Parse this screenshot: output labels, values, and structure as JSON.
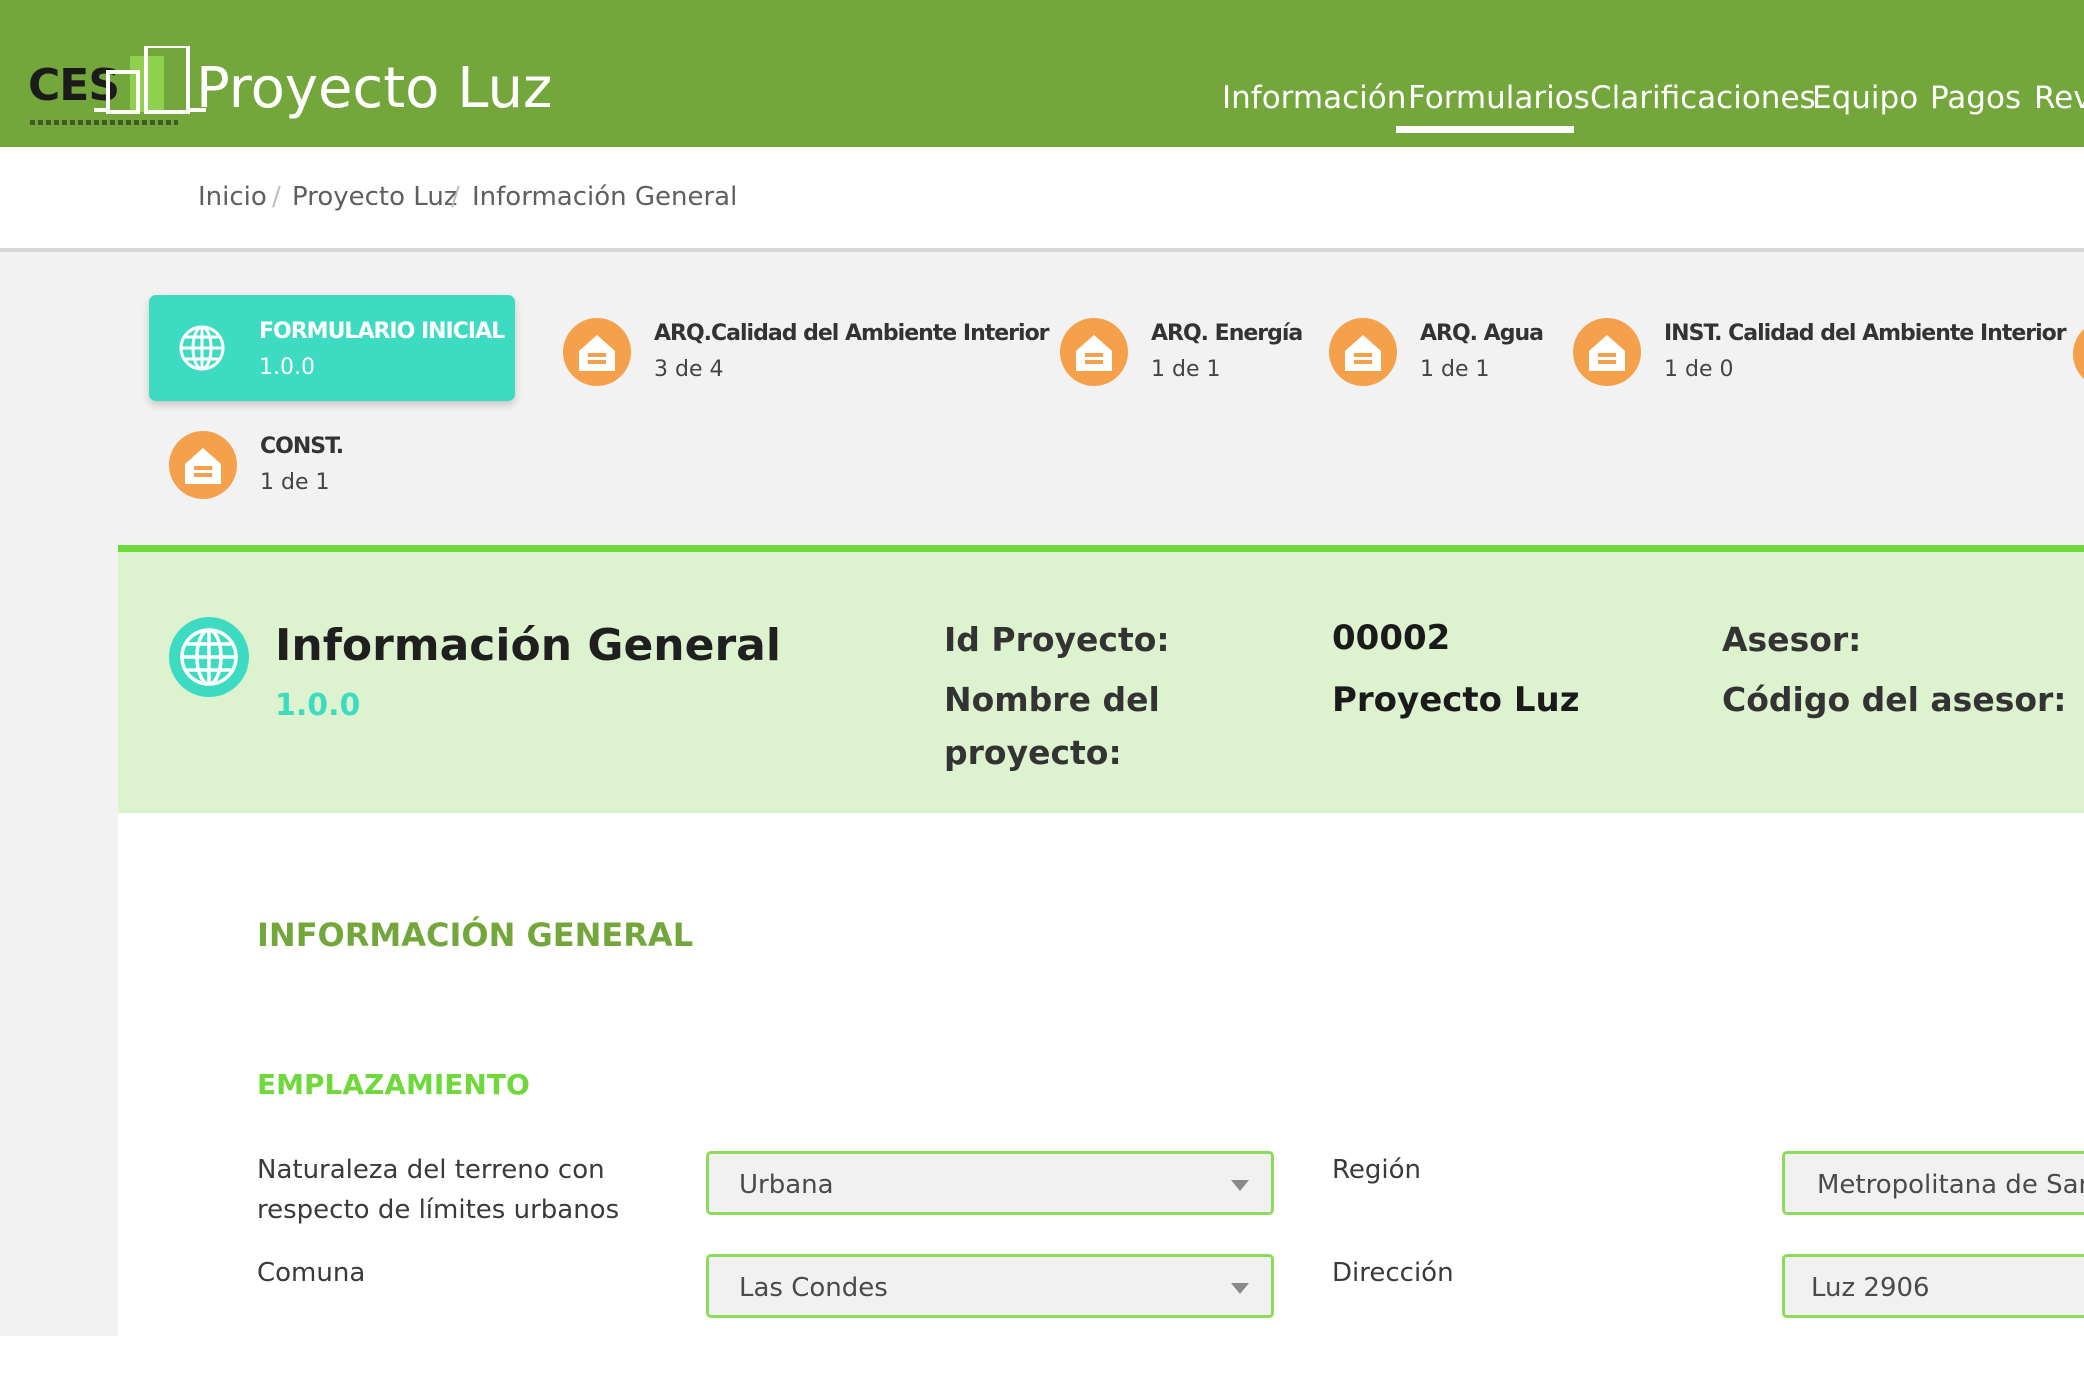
{
  "header": {
    "logo_text": "CES",
    "app_title": "Proyecto Luz",
    "nav": [
      "Información",
      "Formularios",
      "Clarificaciones",
      "Equipo",
      "Pagos",
      "Revi"
    ],
    "active_nav": "Formularios"
  },
  "breadcrumb": [
    "Inicio",
    "Proyecto Luz",
    "Información General"
  ],
  "steps": {
    "active": {
      "label": "FORMULARIO INICIAL",
      "version": "1.0.0"
    },
    "items": [
      {
        "label": "ARQ.Calidad del Ambiente Interior",
        "count": "3 de 4"
      },
      {
        "label": "ARQ. Energía",
        "count": "1 de 1"
      },
      {
        "label": "ARQ. Agua",
        "count": "1 de 1"
      },
      {
        "label": "INST. Calidad del Ambiente Interior",
        "count": "1 de 0"
      },
      {
        "label": "CONST.",
        "count": "1 de 1"
      }
    ]
  },
  "card": {
    "title": "Información General",
    "version": "1.0.0",
    "id_label": "Id Proyecto:",
    "id_value": "00002",
    "name_label_1": "Nombre del",
    "name_label_2": "proyecto:",
    "name_value": "Proyecto Luz",
    "asesor_label": "Asesor:",
    "codigo_label": "Código del asesor:"
  },
  "form": {
    "section_title": "INFORMACIÓN GENERAL",
    "subsection_title": "EMPLAZAMIENTO",
    "naturaleza_label_1": "Naturaleza del terreno con",
    "naturaleza_label_2": "respecto de límites urbanos",
    "naturaleza_value": "Urbana",
    "region_label": "Región",
    "region_value": "Metropolitana de Santi",
    "comuna_label": "Comuna",
    "comuna_value": "Las Condes",
    "direccion_label": "Dirección",
    "direccion_value": "Luz 2906"
  },
  "colors": {
    "header_green": "#73a73c",
    "accent_teal": "#3ddbc1",
    "step_orange": "#f5a04a",
    "card_green_bg": "#ddf3cf",
    "field_border": "#8ddc59"
  },
  "icons": [
    "globe-icon",
    "house-form-icon",
    "chevron-down-icon"
  ]
}
